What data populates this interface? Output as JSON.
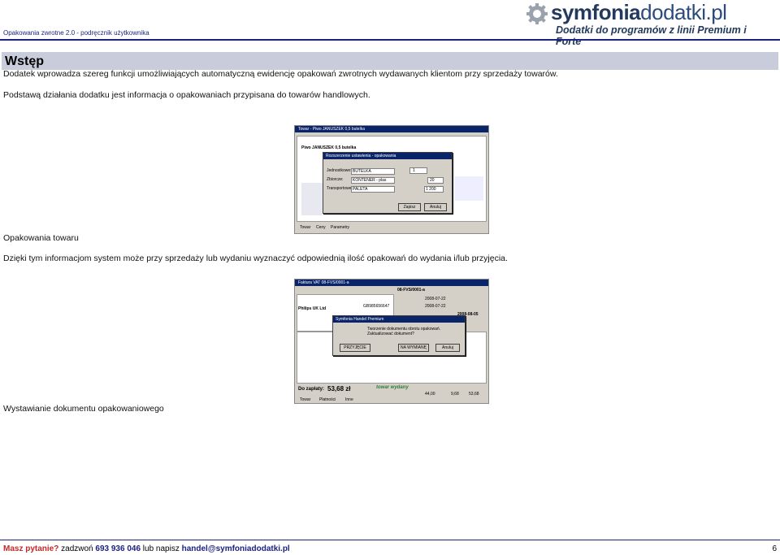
{
  "header": {
    "doc_title": "Opakowania zwrotne 2.0  - podręcznik użytkownika",
    "logo_brand_a": "symfonia",
    "logo_brand_b": "dodatki.pl",
    "logo_tagline": "Dodatki do programów z linii Premium i Forte"
  },
  "section": {
    "title": "Wstęp"
  },
  "paragraphs": {
    "p1": "Dodatek wprowadza szereg funkcji umożliwiających automatyczną ewidencję opakowań zwrotnych wydawanych klientom przy sprzedaży towarów.",
    "p2": "Podstawą działania dodatku jest informacja o opakowaniach przypisana do towarów handlowych.",
    "p3": "Dzięki tym informacjom system może przy sprzedaży lub wydaniu wyznaczyć odpowiednią ilość opakowań do wydania i/lub przyjęcia."
  },
  "figure1": {
    "caption": "Opakowania towaru",
    "window_title": "Towar - Piwo JANUSZEK 0,5 butelka",
    "product_name": "Piwo JANUSZEK 0,5 butelka",
    "dialog_title": "Rozszerzenie ustawienia - opakowania",
    "rows": [
      {
        "label": "Jednostkowe:",
        "value": "BUTELKA",
        "qty": "1"
      },
      {
        "label": "Zbiorcze:",
        "value": "KONTENER - plas",
        "qty": "20"
      },
      {
        "label": "Transportowe:",
        "value": "PALETA",
        "qty": "1 200"
      }
    ],
    "ok_label": "Zapisz",
    "cancel_label": "Anuluj",
    "tabs": [
      "Towar",
      "Ceny",
      "Parametry"
    ]
  },
  "figure2": {
    "caption": "Wystawianie dokumentu opakowaniowego",
    "window_title": "Faktura VAT 08-FVS/0001-a",
    "doc_number": "08-FVS/0001-a",
    "buyer": "Philips UK Ltd",
    "nip": "GB985656647",
    "date_issue": "2008-07-22",
    "date_sale": "2008-07-22",
    "date_pay": "2008-08-05",
    "dialog_title": "Symfonia Handel Premium",
    "dialog_text": "Tworzenie dokumentu obrotu opakowań. Zaktualizować dokument?",
    "btn_accept": "PRZYJĘCIE",
    "btn_issue": "NA WYMIANĘ",
    "btn_cancel": "Anuluj",
    "total_label": "Do zapłaty:",
    "total_value": "53,68 zł",
    "stamp": "towar wydany",
    "netto": "44,00",
    "vat": "9,68",
    "brutto": "53,68",
    "tabs": [
      "Towar",
      "Płatności",
      "Inne"
    ]
  },
  "footer": {
    "question": "Masz pytanie?",
    "call": "zadzwoń",
    "phone": "693 936 046",
    "or_write": "lub napisz",
    "email": "handel@symfoniadodatki.pl",
    "page": "6"
  }
}
